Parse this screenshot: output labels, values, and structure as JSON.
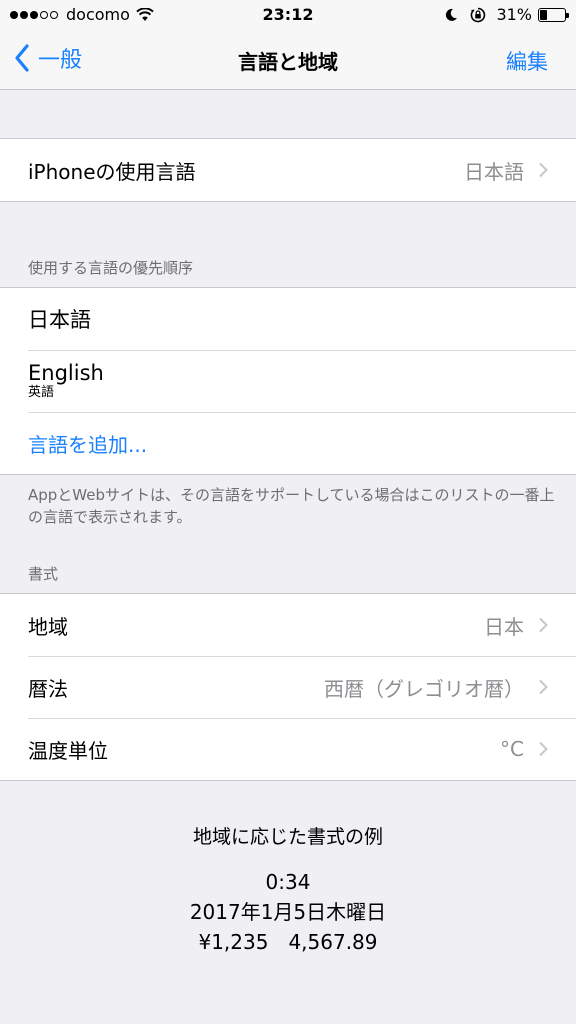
{
  "status": {
    "carrier": "docomo",
    "time": "23:12",
    "battery": "31%",
    "battery_level": 0.31,
    "signal_bars": 3
  },
  "nav": {
    "back_label": "一般",
    "title": "言語と地域",
    "edit_label": "編集"
  },
  "device_language": {
    "label": "iPhoneの使用言語",
    "value": "日本語"
  },
  "preferred_languages": {
    "header": "使用する言語の優先順序",
    "items": [
      {
        "label": "日本語",
        "sub": ""
      },
      {
        "label": "English",
        "sub": "英語"
      }
    ],
    "add_label": "言語を追加...",
    "footer": "AppとWebサイトは、その言語をサポートしている場合はこのリストの一番上の言語で表示されます。"
  },
  "format": {
    "header": "書式",
    "rows": [
      {
        "label": "地域",
        "value": "日本"
      },
      {
        "label": "暦法",
        "value": "西暦（グレゴリオ暦）"
      },
      {
        "label": "温度単位",
        "value": "°C"
      }
    ]
  },
  "example": {
    "title": "地域に応じた書式の例",
    "time": "0:34",
    "date": "2017年1月5日木曜日",
    "numbers": "¥1,235　4,567.89"
  },
  "colors": {
    "accent": "#1a80ff",
    "background": "#efeff4",
    "secondary_text": "#8e8e93"
  }
}
